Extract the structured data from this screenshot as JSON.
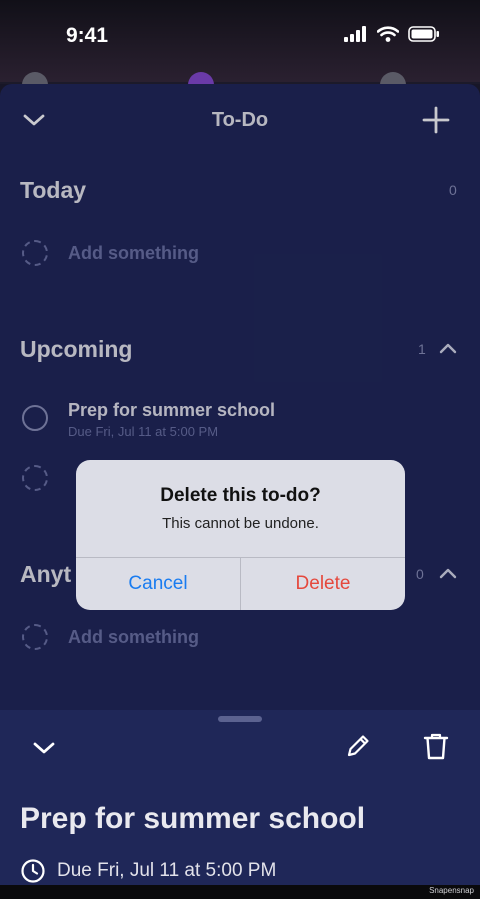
{
  "status_bar": {
    "time": "9:41"
  },
  "header": {
    "title": "To-Do"
  },
  "sections": {
    "today": {
      "title": "Today",
      "count": "0",
      "add_label": "Add something"
    },
    "upcoming": {
      "title": "Upcoming",
      "count": "1",
      "items": [
        {
          "title": "Prep for summer school",
          "due": "Due Fri, Jul 11 at 5:00 PM"
        }
      ]
    },
    "anytime": {
      "title_visible": "Anyt",
      "count": "0",
      "add_label": "Add something"
    }
  },
  "alert": {
    "title": "Delete this to-do?",
    "message": "This cannot be undone.",
    "cancel_label": "Cancel",
    "delete_label": "Delete"
  },
  "detail": {
    "title": "Prep for summer school",
    "due": "Due Fri, Jul 11 at 5:00 PM"
  },
  "watermark": "Snapensnap",
  "colors": {
    "sheet": "#1f2656",
    "muted": "#6c73a4",
    "cancel": "#1a7cf0",
    "delete": "#e5483d"
  }
}
